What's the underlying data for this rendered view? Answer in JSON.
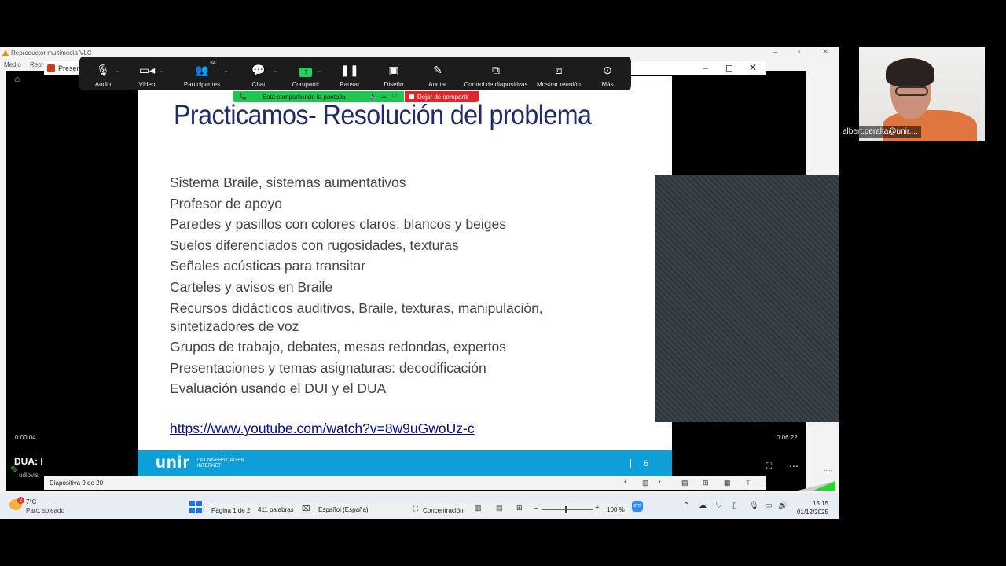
{
  "vlc": {
    "title": "Reproductor multimedia VLC",
    "menu_medio": "Medio",
    "menu_repro": "Repr",
    "time_elapsed": "0:00:04",
    "time_total": "0:06:22",
    "media_title": "DUA: I",
    "media_subtitle": "udiovis",
    "volume_level": "--:--"
  },
  "ppt": {
    "window_title": "Present",
    "slide_indicator": "Diapositiva 9 de 20"
  },
  "zoom_toolbar": {
    "audio": "Audio",
    "video": "Vídeo",
    "participants": "Participantes",
    "participants_count": "34",
    "chat": "Chat",
    "share": "Compartir",
    "pause": "Pausar",
    "design": "Diseño",
    "annotate": "Anotar",
    "slide_control": "Control de diapositivas",
    "show_meeting": "Mostrar reunión",
    "more": "Más",
    "sharing_banner": "Está compartiendo la pantalla",
    "stop_sharing": "Dejar de compartir"
  },
  "slide": {
    "title": "Practicamos- Resolución del problema",
    "bullets": [
      "Sistema Braile, sistemas aumentativos",
      "Profesor de apoyo",
      "Paredes y pasillos con colores claros: blancos y beiges",
      "Suelos diferenciados con rugosidades, texturas",
      "Señales acústicas para transitar",
      "Carteles y avisos en Braile",
      "Recursos didácticos auditivos, Braile, texturas, manipulación, sintetizadores de voz",
      "Grupos de trabajo, debates, mesas redondas, expertos",
      "Presentaciones y temas asignaturas: decodificación",
      "Evaluación usando el DUI y el DUA"
    ],
    "link": "https://www.youtube.com/watch?v=8w9uGwoUz-c",
    "footer_brand": "unir",
    "footer_tagline": "LA UNIVERSIDAD EN INTERNET",
    "page_number": "6"
  },
  "participant": {
    "name": "albert.peralta@unir...."
  },
  "taskbar": {
    "weather_badge": "2",
    "temperature": "7°C",
    "weather_desc": "Parc. soleado",
    "page_info": "Página 1 de 2",
    "word_count": "411 palabras",
    "language": "Español (España)",
    "focus": "Concentración",
    "zoom_level": "100 %",
    "time": "15:15",
    "date": "01/12/2025"
  },
  "colors": {
    "slide_title": "#1f2a67",
    "slide_footer": "#0f9fd8",
    "share_green": "#23c552",
    "stop_red": "#e0262b"
  }
}
